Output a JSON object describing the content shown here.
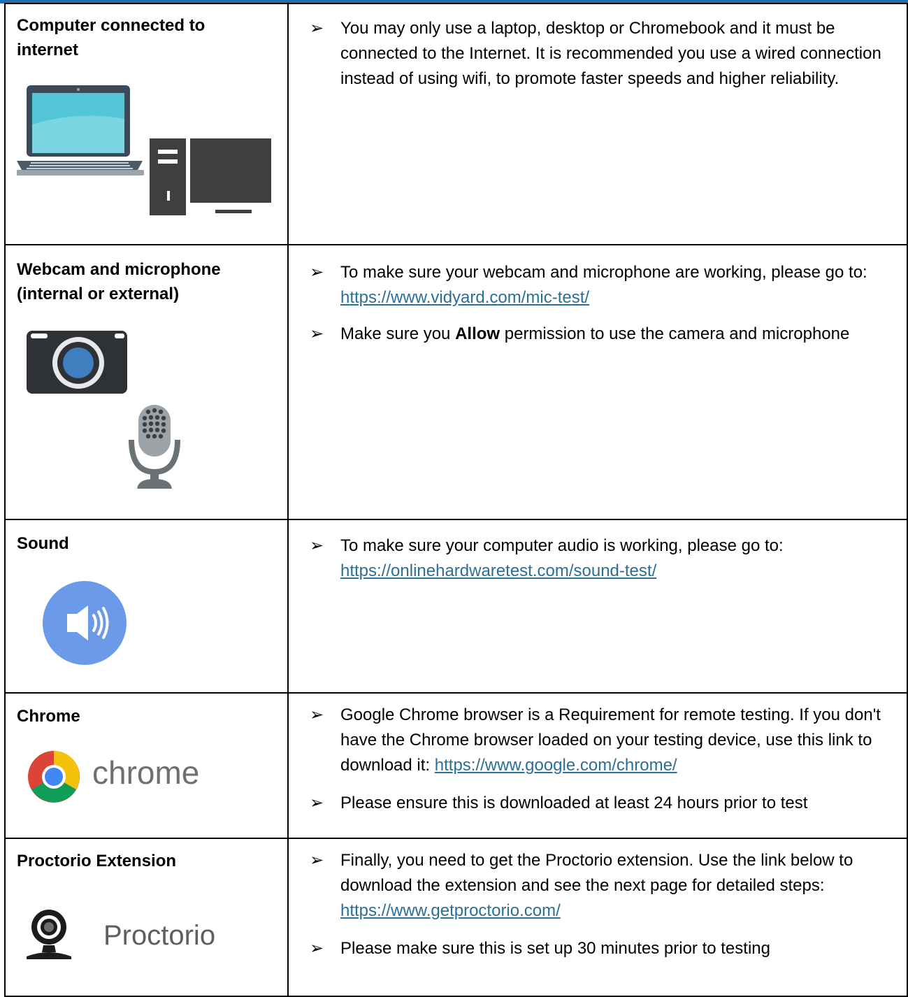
{
  "rows": [
    {
      "label_lines": [
        "Computer connected to",
        "internet"
      ],
      "icon": "computer-icon",
      "bullets": [
        {
          "text": "You may only use a laptop, desktop or Chromebook and it must be connected to the Internet. It is recommended you use a wired connection instead of using wifi, to promote faster speeds and higher reliability."
        }
      ]
    },
    {
      "label_lines": [
        "Webcam and microphone",
        "(internal or external)"
      ],
      "icon": "webcam-microphone-icon",
      "bullets": [
        {
          "pre": "To make sure your webcam and microphone are working, please go to: ",
          "link": "https://www.vidyard.com/mic-test/"
        },
        {
          "pre": "Make sure you ",
          "bold": "Allow",
          "post": " permission to use the camera and microphone"
        }
      ]
    },
    {
      "label_lines": [
        "Sound"
      ],
      "icon": "speaker-icon",
      "bullets": [
        {
          "pre": "To make sure your computer audio is working, please go to: ",
          "link": "https://onlinehardwaretest.com/sound-test/"
        }
      ]
    },
    {
      "label_lines": [
        "Chrome"
      ],
      "icon": "chrome-logo",
      "logo_text": "chrome",
      "bullets": [
        {
          "pre": "Google Chrome browser is a Requirement for remote testing. If you don't have the Chrome browser loaded on your testing device, use this link to download it: ",
          "link": "https://www.google.com/chrome/"
        },
        {
          "text": "Please ensure this is downloaded at least 24 hours prior to test"
        }
      ]
    },
    {
      "label_lines": [
        "Proctorio Extension"
      ],
      "icon": "proctorio-logo",
      "logo_text": "Proctorio",
      "bullets": [
        {
          "pre": "Finally, you need to get the Proctorio extension. Use the link below to download the extension and see the next page for detailed steps: ",
          "link": "https://www.getproctorio.com/"
        },
        {
          "text": "Please make sure this is set up 30 minutes prior to testing"
        }
      ]
    }
  ],
  "bullet_glyph": "➢",
  "colors": {
    "link": "#2a6f97",
    "top_border": "#1f6fb2",
    "speaker_circle": "#6b9be8"
  }
}
